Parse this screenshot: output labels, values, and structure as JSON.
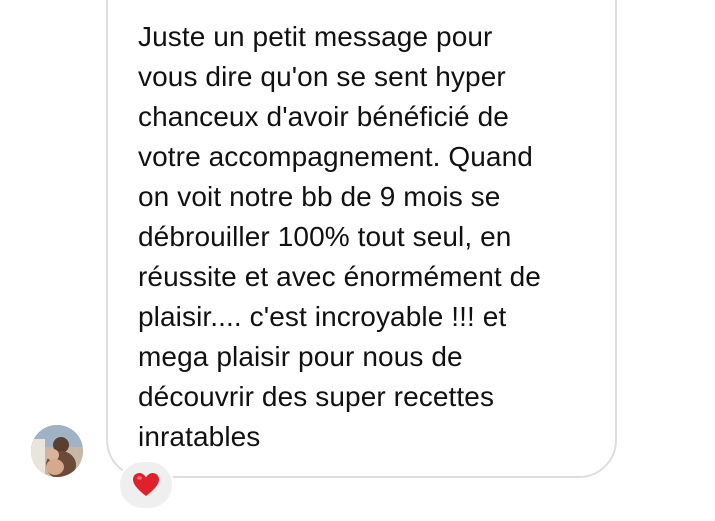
{
  "message": {
    "lines": [
      "Juste un petit message pour",
      "vous dire qu'on se sent hyper",
      "chanceux d'avoir bénéficié de",
      "votre accompagnement. Quand",
      "on voit notre bb de 9 mois se",
      "débrouiller 100% tout seul, en",
      "réussite et avec énormément de",
      "plaisir.... c'est incroyable !!! et",
      "mega plaisir pour nous de",
      "découvrir des super recettes",
      "inratables"
    ]
  },
  "sender": {
    "avatar_icon": "profile-photo"
  },
  "reaction": {
    "icon": "red-heart-icon",
    "color": "#e0202a"
  },
  "colors": {
    "bubble_border": "#dedede",
    "text": "#111111",
    "reaction_bg": "#efefef"
  }
}
